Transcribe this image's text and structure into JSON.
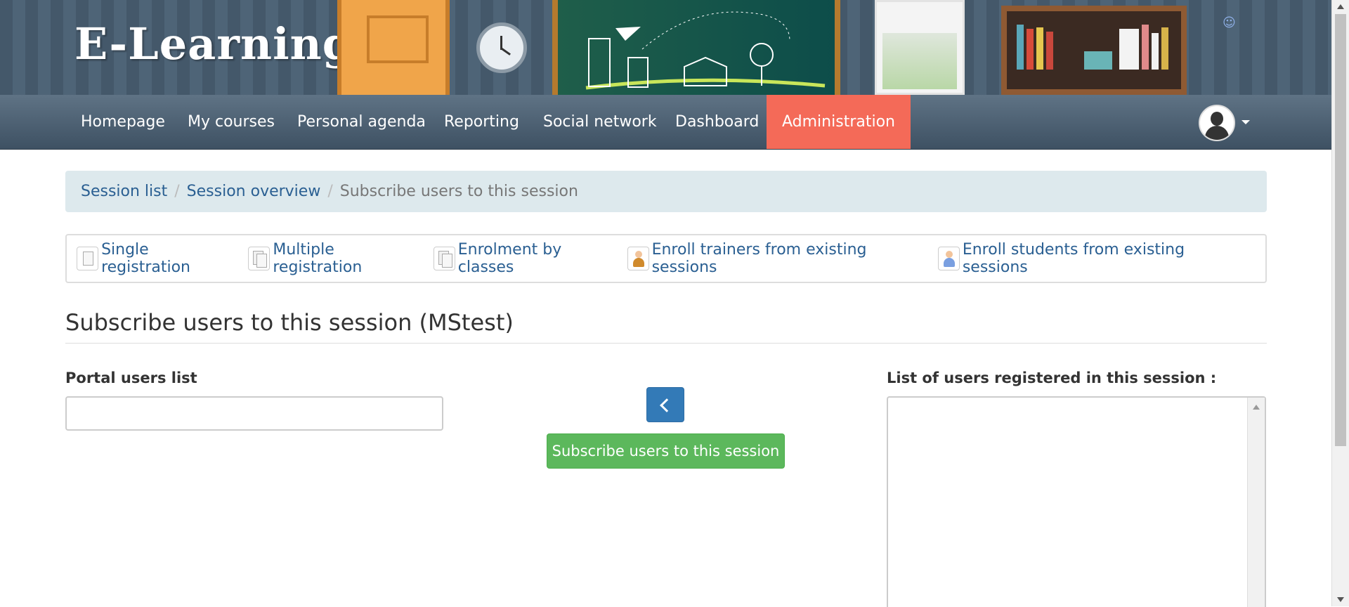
{
  "header": {
    "logo_text": "E-Learning",
    "illustration": "classroom-banner-illustration"
  },
  "nav": {
    "items": [
      {
        "label": "Homepage"
      },
      {
        "label": "My courses"
      },
      {
        "label": "Personal agenda"
      },
      {
        "label": "Reporting"
      },
      {
        "label": "Social network"
      },
      {
        "label": "Dashboard"
      },
      {
        "label": "Administration",
        "active": true
      }
    ],
    "active_color": "#f46a58",
    "user_icon": "user-avatar-icon"
  },
  "breadcrumb": {
    "items": [
      "Session list",
      "Session overview"
    ],
    "current": "Subscribe users to this session",
    "separator": "/"
  },
  "toolbar": {
    "items": [
      {
        "label": "Single registration",
        "icon": "document-icon"
      },
      {
        "label": "Multiple registration",
        "icon": "documents-icon"
      },
      {
        "label": "Enrolment by classes",
        "icon": "documents-icon"
      },
      {
        "label": "Enroll trainers from existing sessions",
        "icon": "trainer-icon"
      },
      {
        "label": "Enroll students from existing sessions",
        "icon": "student-icon"
      }
    ]
  },
  "page": {
    "title": "Subscribe users to this session (MStest)"
  },
  "form": {
    "portal_users_label": "Portal users list",
    "portal_users_value": "",
    "move_left_icon": "chevron-left-icon",
    "subscribe_button": "Subscribe users to this session",
    "registered_label": "List of users registered in this session :",
    "registered_users": []
  },
  "colors": {
    "navbar": "#4a5e70",
    "primary": "#337ab7",
    "success": "#5cb85c",
    "link": "#2a5f92",
    "breadcrumb_bg": "#dde9ed"
  }
}
